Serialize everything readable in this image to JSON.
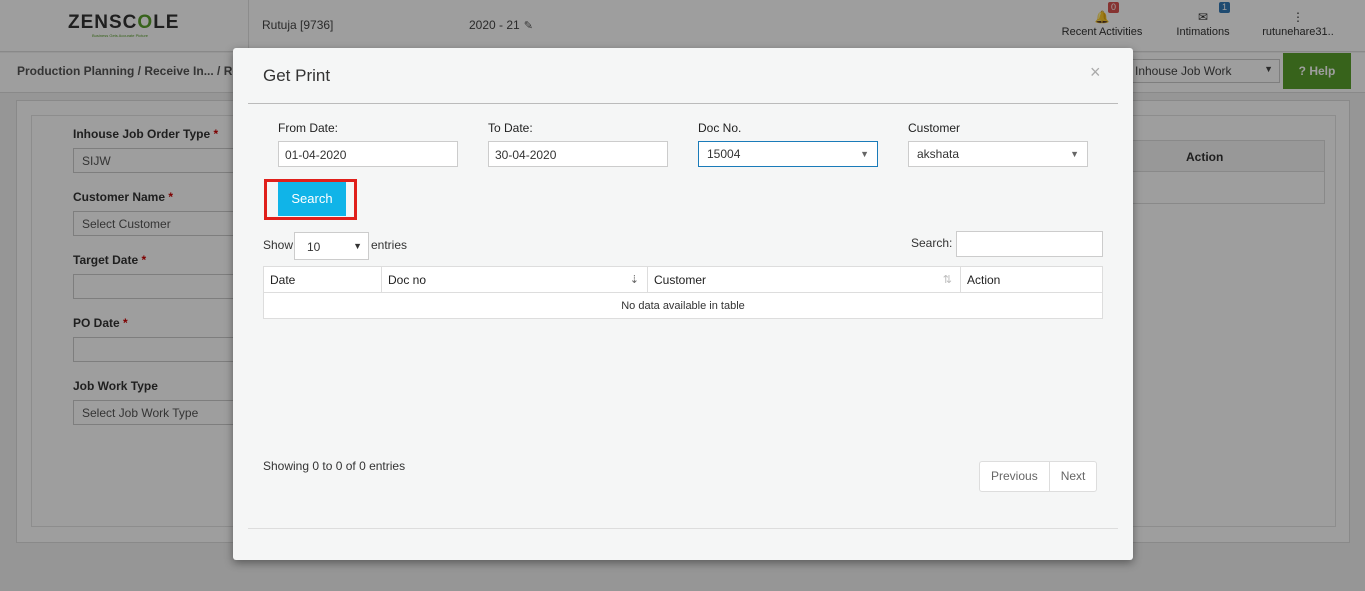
{
  "topbar": {
    "logo_prefix": "ZENSC",
    "logo_accent": "O",
    "logo_suffix": "LE",
    "logo_tagline": "Business Gets Accurate Picture",
    "user": "Rutuja [9736]",
    "financial_year": "2020 - 21",
    "recent_activities": {
      "label": "Recent Activities",
      "count": "0"
    },
    "intimations": {
      "label": "Intimations",
      "count": "1"
    },
    "account": "rutunehare31.."
  },
  "breadcrumb": "Production Planning  / Receive In... / Rec",
  "job_work_select": "Inhouse Job Work",
  "help_label": "Help",
  "background_form": {
    "inhouse_job_order_type": {
      "label": "Inhouse Job Order Type",
      "value": "SIJW"
    },
    "customer_name": {
      "label": "Customer Name",
      "placeholder": "Select Customer"
    },
    "target_date": {
      "label": "Target Date"
    },
    "po_date": {
      "label": "PO Date"
    },
    "job_work_type": {
      "label": "Job Work Type",
      "placeholder": "Select Job Work Type"
    },
    "table_action": "Action"
  },
  "modal": {
    "title": "Get Print",
    "close": "×",
    "from_date": {
      "label": "From Date:",
      "value": "01-04-2020"
    },
    "to_date": {
      "label": "To Date:",
      "value": "30-04-2020"
    },
    "doc_no": {
      "label": "Doc No.",
      "value": "15004"
    },
    "customer": {
      "label": "Customer",
      "value": "akshata"
    },
    "search_button": "Search",
    "show_label": "Show",
    "page_length": "10",
    "entries_label": "entries",
    "search_label": "Search:",
    "columns": [
      "Date",
      "Doc no",
      "Customer",
      "Action"
    ],
    "empty_message": "No data available in table",
    "info": "Showing 0 to 0 of 0 entries",
    "previous": "Previous",
    "next": "Next"
  },
  "colors": {
    "brand_green": "#5aa02c",
    "search_button": "#10b4e8",
    "highlight": "#e0201b"
  }
}
